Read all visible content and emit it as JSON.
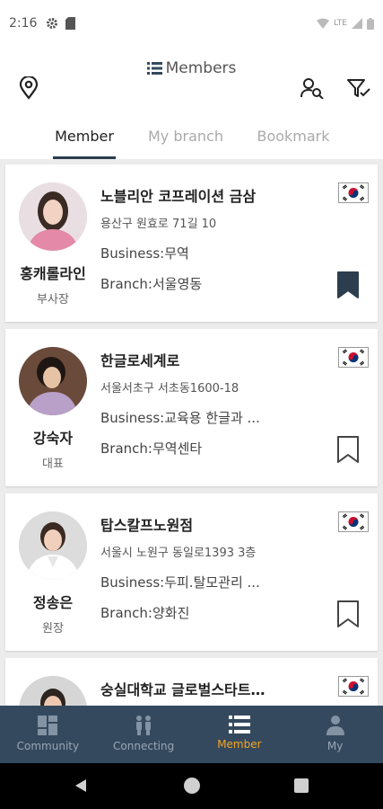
{
  "status_bar": {
    "time": "2:16",
    "network": "LTE"
  },
  "header": {
    "title": "Members"
  },
  "tabs": [
    {
      "label": "Member",
      "active": true
    },
    {
      "label": "My branch",
      "active": false
    },
    {
      "label": "Bookmark",
      "active": false
    }
  ],
  "members": [
    {
      "name": "홍캐롤라인",
      "role": "부사장",
      "company": "노블리안 코프레이션 금삼",
      "address": "용산구 원효로 71길 10",
      "business": "Business:무역",
      "branch": "Branch:서울영동",
      "bookmarked": true
    },
    {
      "name": "강숙자",
      "role": "대표",
      "company": "한글로세계로",
      "address": "서울서초구 서초동1600-18",
      "business": "Business:교육용  한글과 ...",
      "branch": "Branch:무역센타",
      "bookmarked": false
    },
    {
      "name": "정송은",
      "role": "원장",
      "company": "탑스칼프노원점",
      "address": "서울시 노원구 동일로1393 3층",
      "business": "Business:두피.탈모관리 ...",
      "branch": "Branch:양화진",
      "bookmarked": false
    },
    {
      "name": "",
      "role": "",
      "company": "숭실대학교 글로벌스타트…",
      "address": "",
      "business": "",
      "branch": "",
      "bookmarked": false
    }
  ],
  "bottom_nav": [
    {
      "label": "Community",
      "icon": "dashboard-icon",
      "active": false
    },
    {
      "label": "Connecting",
      "icon": "people-icon",
      "active": false
    },
    {
      "label": "Member",
      "icon": "list-icon",
      "active": true
    },
    {
      "label": "My",
      "icon": "person-icon",
      "active": false
    }
  ],
  "colors": {
    "accent": "#f5a623",
    "nav_bg": "#34495e",
    "tab_indicator": "#2c3e4e",
    "bookmark": "#2c3e4e"
  }
}
